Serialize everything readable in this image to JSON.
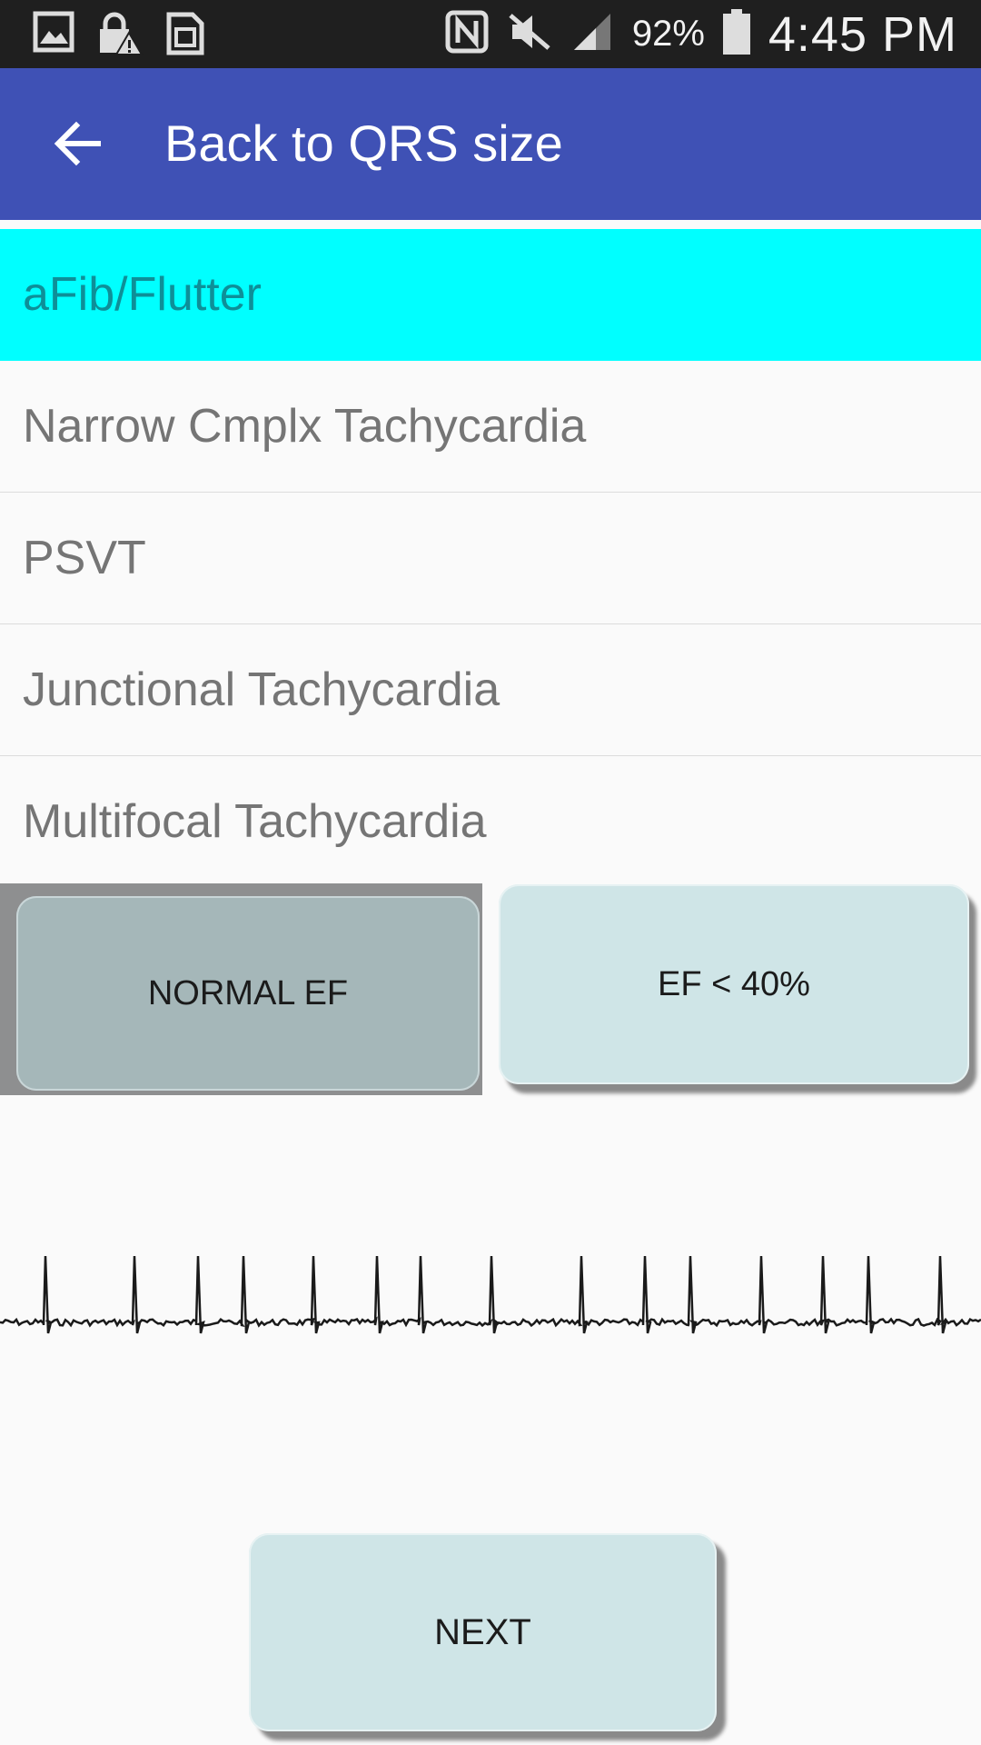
{
  "status_bar": {
    "battery": "92%",
    "time": "4:45 PM",
    "icons": [
      "image-icon",
      "lock-alert-icon",
      "sim-card-icon",
      "nfc-icon",
      "mute-icon",
      "signal-icon",
      "battery-icon"
    ]
  },
  "app_bar": {
    "title": "Back to QRS size",
    "back_icon": "arrow-left-icon",
    "color": "#3f51b5"
  },
  "list": {
    "selected_color": "#00ffff",
    "items": [
      {
        "label": "aFib/Flutter",
        "selected": true
      },
      {
        "label": "Narrow Cmplx Tachycardia",
        "selected": false
      },
      {
        "label": "PSVT",
        "selected": false
      },
      {
        "label": "Junctional Tachycardia",
        "selected": false
      },
      {
        "label": "Multifocal Tachycardia",
        "selected": false
      }
    ]
  },
  "buttons": {
    "normal_ef": "NORMAL EF",
    "low_ef": "EF < 40%",
    "next": "NEXT"
  },
  "ecg_strip": {
    "description_icon": "ecg-rhythm-strip"
  }
}
